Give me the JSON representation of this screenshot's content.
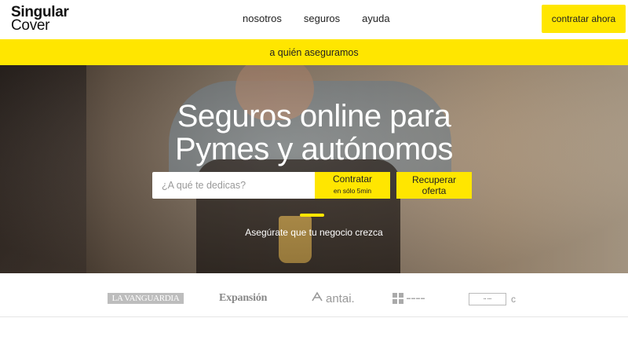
{
  "header": {
    "logo_line1": "Singular",
    "logo_line2": "Cover",
    "nav": [
      "nosotros",
      "seguros",
      "ayuda"
    ],
    "cta_label": "contratar ahora"
  },
  "banner": {
    "label": "a quién aseguramos"
  },
  "hero": {
    "title_line1": "Seguros online para",
    "title_line2": "Pymes y autónomos",
    "search_placeholder": "¿A qué te dedicas?",
    "contratar_label": "Contratar",
    "contratar_sub": "en sólo 5min",
    "recuperar_line1": "Recuperar",
    "recuperar_line2": "oferta",
    "tagline": "Asegúrate que tu negocio crezca"
  },
  "press": {
    "logos": [
      "LA VANGUARDIA",
      "Expansión",
      "antai.",
      "",
      ""
    ]
  },
  "colors": {
    "accent": "#ffe600",
    "text": "#222222"
  },
  "icons": {
    "antai": "antai-logo-icon"
  }
}
